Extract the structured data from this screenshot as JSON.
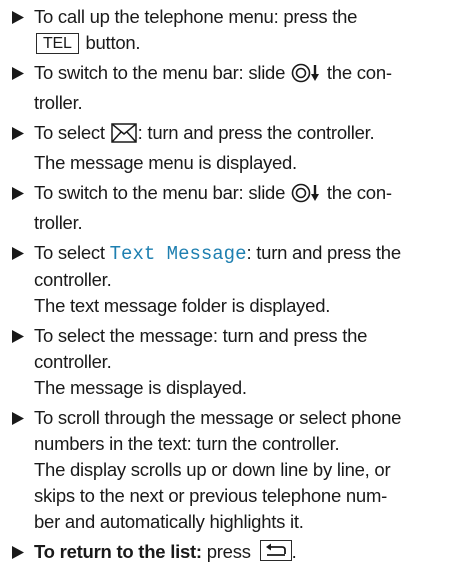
{
  "steps": [
    {
      "lines": {
        "a1": "To call up the telephone menu: press the",
        "key": "TEL",
        "a2": "button."
      }
    },
    {
      "lines": {
        "a1": "To switch to the menu bar: slide",
        "a2": "the con-",
        "b": "troller."
      }
    },
    {
      "lines": {
        "a1": "To select",
        "a2": ": turn and press the controller.",
        "b": "The message menu is displayed."
      }
    },
    {
      "lines": {
        "a1": "To switch to the menu bar: slide",
        "a2": "the con-",
        "b": "troller."
      }
    },
    {
      "lines": {
        "a1": "To select",
        "mono": "Text Message",
        "a2": ": turn and press the",
        "b": "controller.",
        "c": "The text message folder is displayed."
      }
    },
    {
      "lines": {
        "a1": "To select the message: turn and press the",
        "b": "controller.",
        "c": "The message is displayed."
      }
    },
    {
      "lines": {
        "a": "To scroll through the message or select phone",
        "b": "numbers in the text: turn the controller.",
        "c": "The display scrolls up or down line by line, or",
        "d": "skips to the next or previous telephone num-",
        "e": "ber and automatically highlights it."
      }
    },
    {
      "lines": {
        "bold": "To return to the list:",
        "a2": "press"
      }
    }
  ],
  "icons": {
    "bullet": "triangle-bullet-icon",
    "controller": "controller-slide-down-icon",
    "envelope": "envelope-icon",
    "back": "back-key-icon"
  },
  "colors": {
    "text": "#1a1a1a",
    "highlight": "#1e7fb0"
  }
}
